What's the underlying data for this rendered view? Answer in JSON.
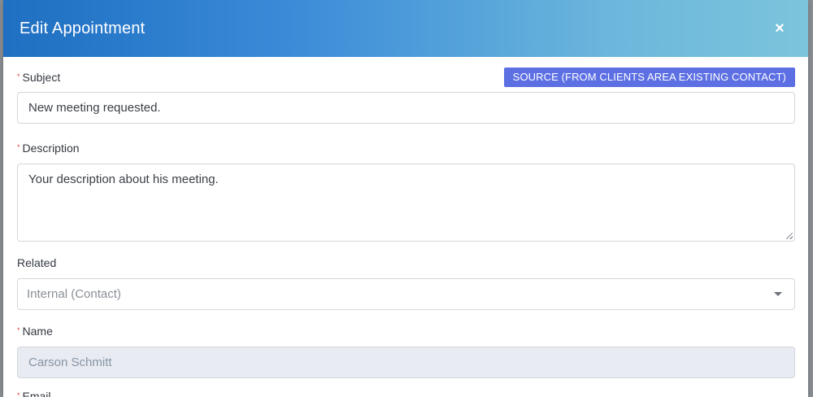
{
  "modal": {
    "title": "Edit Appointment",
    "close_label": "×"
  },
  "form": {
    "source_button": "SOURCE (FROM CLIENTS AREA EXISTING CONTACT)",
    "required_marker": "*",
    "subject": {
      "label": "Subject",
      "value": "New meeting requested."
    },
    "description": {
      "label": "Description",
      "value": "Your description about his meeting."
    },
    "related": {
      "label": "Related",
      "selected": "Internal (Contact)"
    },
    "name": {
      "label": "Name",
      "value": "Carson Schmitt"
    },
    "next_label": "Email"
  },
  "colors": {
    "header_start": "#1f6fc2",
    "header_end": "#7cc4dc",
    "source_button": "#5c6fe3",
    "required": "#e04848"
  }
}
